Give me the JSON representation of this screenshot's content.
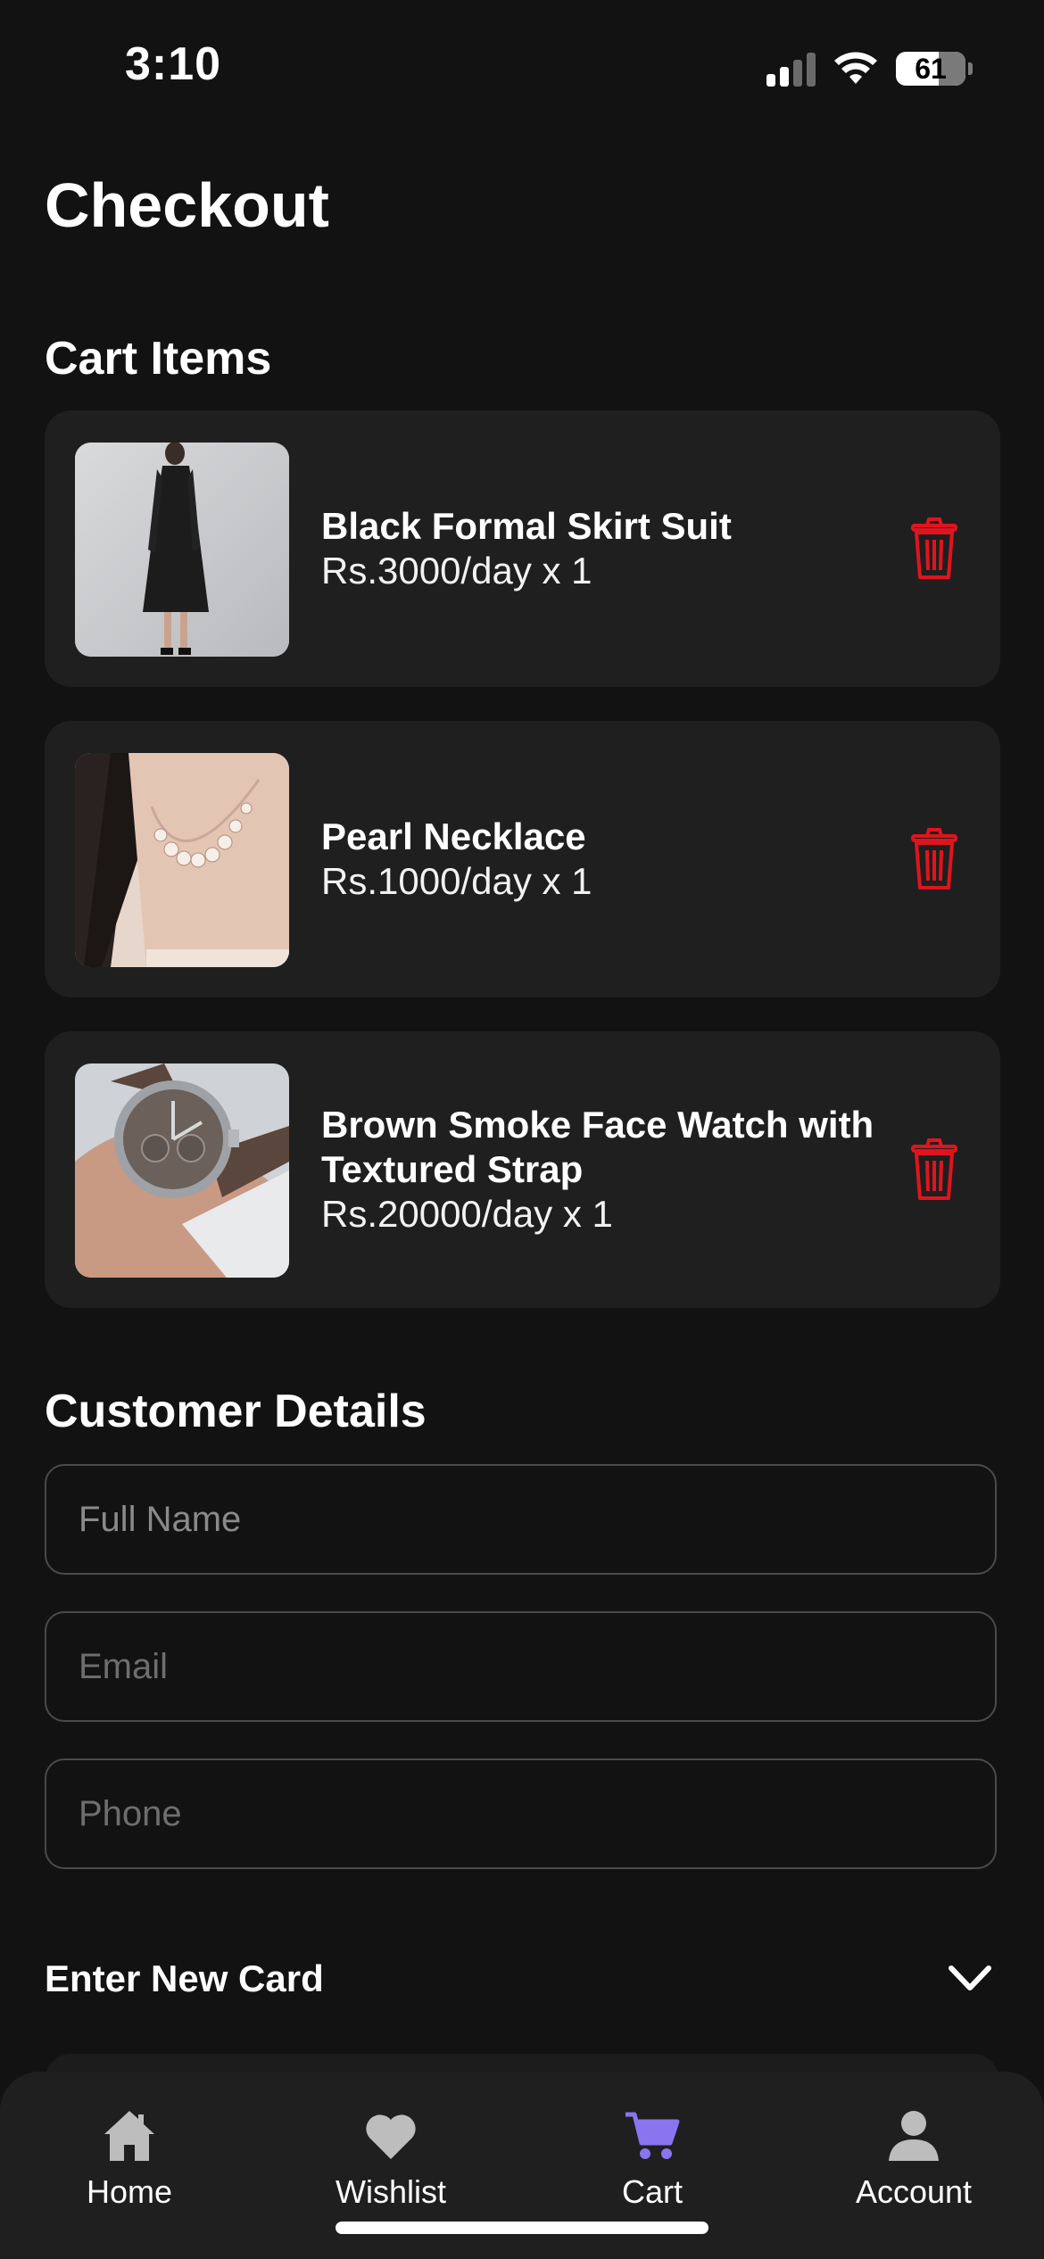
{
  "status_bar": {
    "time": "3:10",
    "battery_percent": "61",
    "signal_bars_active": 2,
    "signal_bars_total": 4
  },
  "page": {
    "title": "Checkout"
  },
  "cart": {
    "section_title": "Cart Items",
    "items": [
      {
        "name": "Black Formal Skirt Suit",
        "price": "Rs.3000/day x 1",
        "image": "black-dress-photo"
      },
      {
        "name": "Pearl Necklace",
        "price": "Rs.1000/day x 1",
        "image": "necklace-photo"
      },
      {
        "name": "Brown Smoke Face Watch with Textured Strap",
        "price": "Rs.20000/day x 1",
        "image": "watch-photo"
      }
    ],
    "delete_icon": "trash-icon",
    "delete_color": "#e0141e"
  },
  "customer": {
    "section_title": "Customer Details",
    "full_name_placeholder": "Full Name",
    "email_placeholder": "Email",
    "phone_placeholder": "Phone"
  },
  "payment": {
    "card_label": "Enter New Card",
    "toggle_icon": "chevron-down-icon"
  },
  "nav": {
    "active_color": "#8a74f0",
    "items": [
      {
        "label": "Home",
        "icon": "home-icon",
        "active": false
      },
      {
        "label": "Wishlist",
        "icon": "heart-icon",
        "active": false
      },
      {
        "label": "Cart",
        "icon": "cart-icon",
        "active": true
      },
      {
        "label": "Account",
        "icon": "user-icon",
        "active": false
      }
    ]
  }
}
